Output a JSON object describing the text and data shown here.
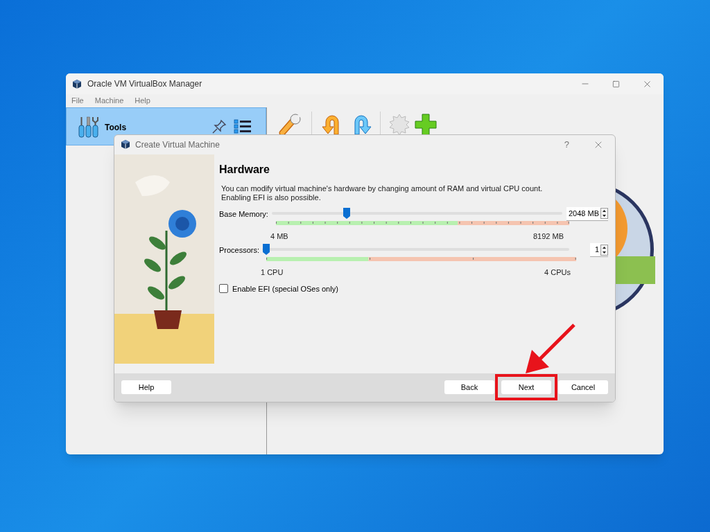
{
  "main_window": {
    "title": "Oracle VM VirtualBox Manager",
    "menu": [
      "File",
      "Machine",
      "Help"
    ],
    "tools_label": "Tools"
  },
  "dialog": {
    "title": "Create Virtual Machine",
    "help_glyph": "?",
    "heading": "Hardware",
    "description_lines": [
      "You can modify virtual machine's hardware by changing amount of RAM and virtual CPU count.",
      "Enabling EFI is also possible."
    ],
    "memory": {
      "label": "Base Memory:",
      "level": 0.25,
      "value": "2048 MB",
      "min_label": "4 MB",
      "max_label": "8192 MB"
    },
    "processors": {
      "label": "Processors:",
      "level": 0,
      "value": "1",
      "min_label": "1 CPU",
      "max_label": "4 CPUs"
    },
    "efi": {
      "label": "Enable EFI (special OSes only)",
      "checked": false
    },
    "buttons": [
      {
        "label": "Help",
        "highlighted": false
      },
      {
        "label": "Back",
        "highlighted": false
      },
      {
        "label": "Next",
        "highlighted": true
      },
      {
        "label": "Cancel",
        "highlighted": false
      }
    ]
  }
}
